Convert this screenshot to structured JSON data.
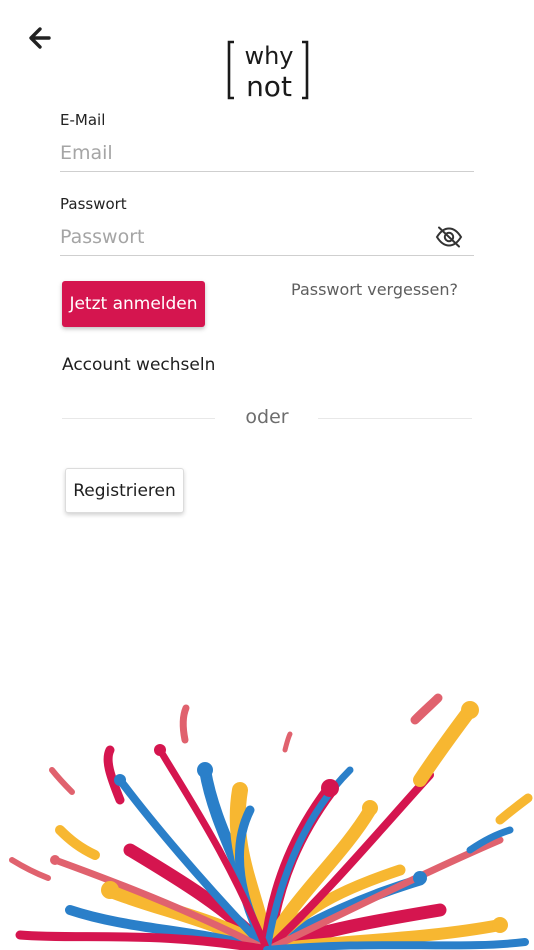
{
  "header": {
    "back_icon": "arrow-left-icon",
    "logo": {
      "line1": "why",
      "line2": "not"
    }
  },
  "form": {
    "email": {
      "label": "E-Mail",
      "placeholder": "Email",
      "value": ""
    },
    "password": {
      "label": "Passwort",
      "placeholder": "Passwort",
      "value": "",
      "toggle_icon": "eye-off-icon"
    },
    "login_label": "Jetzt anmelden",
    "forgot_label": "Passwort vergessen?",
    "switch_account_label": "Account wechseln",
    "divider_label": "oder",
    "register_label": "Registrieren"
  },
  "colors": {
    "accent": "#d5154f",
    "splash_yellow": "#f7b731",
    "splash_blue": "#2a7fc9",
    "splash_pink": "#d5154f",
    "splash_coral": "#e0626e"
  }
}
